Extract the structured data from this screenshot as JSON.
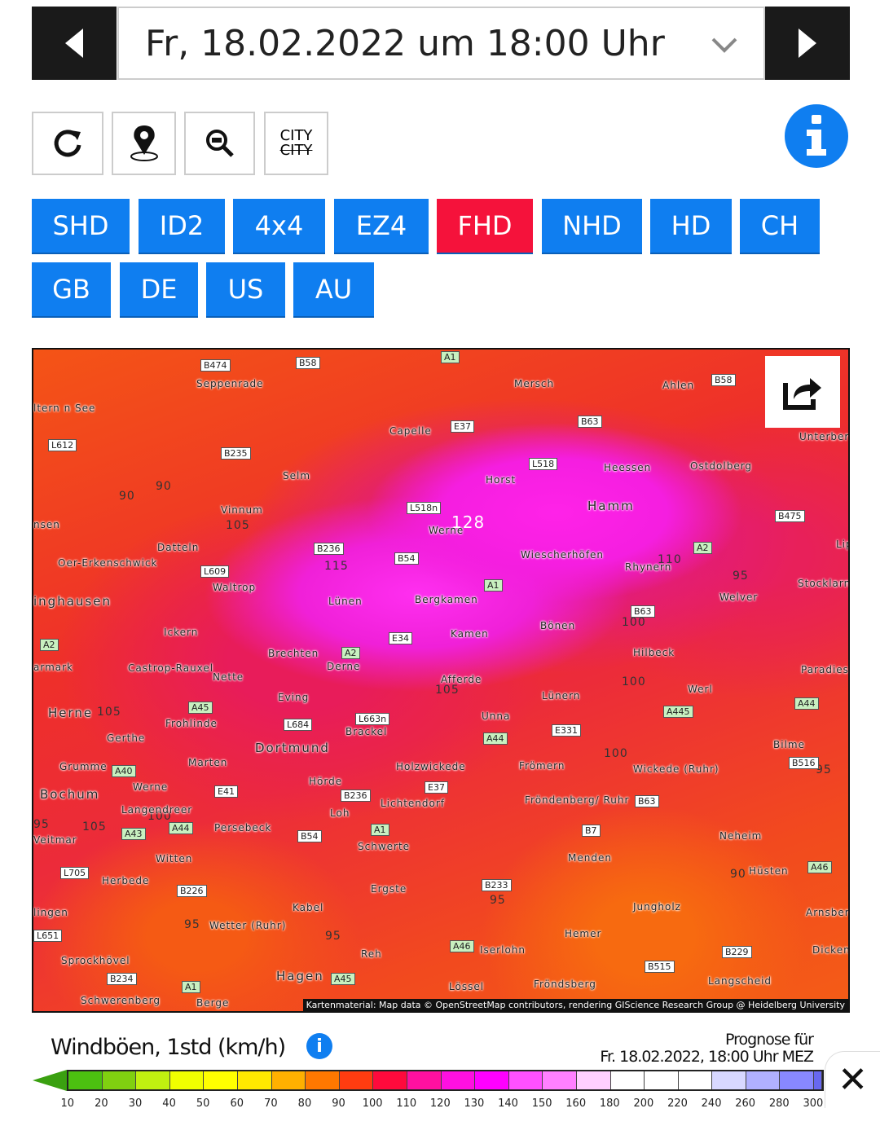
{
  "header": {
    "date_label": "Fr, 18.02.2022 um 18:00 Uhr",
    "prev_icon": "triangle-left",
    "next_icon": "triangle-right",
    "dropdown_icon": "chevron-down"
  },
  "toolbar": {
    "refresh_icon": "refresh",
    "location_icon": "map-pin",
    "zoom_out_icon": "zoom-out",
    "city_top": "CITY",
    "city_bottom": "CITY",
    "info_icon": "info"
  },
  "models": [
    {
      "label": "SHD"
    },
    {
      "label": "ID2"
    },
    {
      "label": "4x4"
    },
    {
      "label": "EZ4"
    },
    {
      "label": "FHD",
      "active": true
    },
    {
      "label": "NHD"
    },
    {
      "label": "HD"
    },
    {
      "label": "CH"
    },
    {
      "label": "GB"
    },
    {
      "label": "DE"
    },
    {
      "label": "US"
    },
    {
      "label": "AU"
    }
  ],
  "colors": {
    "accent": "#0f7ef0",
    "active": "#f5123b",
    "dark": "#1a1a1a"
  },
  "map": {
    "places": [
      "Seppenrade",
      "Mersch",
      "Ahlen",
      "Capelle",
      "Selm",
      "Horst",
      "Heessen",
      "Ostdolberg",
      "Hamm",
      "Werne",
      "Vinnum",
      "Datteln",
      "Oer-Erkenschwick",
      "Waltrop",
      "Lünen",
      "Bergkamen",
      "Wiescherhöfen",
      "Rhynern",
      "Welver",
      "Stocklarn",
      "Ickern",
      "Bönen",
      "Brechten",
      "Derne",
      "Kamen",
      "Hilbeck",
      "Castrop-Rauxel",
      "Nette",
      "Afferde",
      "Werl",
      "Eving",
      "Herne",
      "Lünern",
      "Unna",
      "Frohlinde",
      "Brackel",
      "Gerthe",
      "Dortmund",
      "Bilme",
      "Grumme",
      "Marten",
      "Holzwickede",
      "Frömern",
      "Wickede (Ruhr)",
      "Bochum",
      "Werne",
      "Hörde",
      "Langendreer",
      "Lichtendorf",
      "Fröndenberg/ Ruhr",
      "Loh",
      "Persebeck",
      "Schwerte",
      "Neheim",
      "Witten",
      "Menden",
      "Herbede",
      "Hüsten",
      "Ergste",
      "Kabel",
      "Jungholz",
      "Wetter (Ruhr)",
      "Hemer",
      "Reh",
      "Iserlohn",
      "Sprockhövel",
      "Hagen",
      "Lössel",
      "Fröndsberg",
      "Langscheid",
      "Schwerenberg",
      "Berge",
      "Unterber",
      "Lipp",
      "Paradies",
      "Arnsber",
      "Dicken",
      "lingen",
      "Veitmar",
      "armark",
      "inghausen",
      "nsen",
      "ltern n See"
    ],
    "roads": [
      "B474",
      "B58",
      "A1",
      "E37",
      "B63",
      "B58",
      "B235",
      "L612",
      "L518",
      "B475",
      "L518n",
      "B236",
      "B54",
      "A2",
      "L609",
      "A1",
      "B63",
      "E34",
      "A2",
      "A45",
      "L684",
      "L663n",
      "A445",
      "A44",
      "E331",
      "A44",
      "A40",
      "E41",
      "B236",
      "E37",
      "B516",
      "A43",
      "A44",
      "B54",
      "A1",
      "B63",
      "B7",
      "L705",
      "B226",
      "B233",
      "A46",
      "A46",
      "B229",
      "B515",
      "A45",
      "B234",
      "A1",
      "L651",
      "A2"
    ],
    "isolines": [
      "90",
      "90",
      "105",
      "115",
      "128",
      "110",
      "95",
      "100",
      "105",
      "100",
      "105",
      "100",
      "95",
      "105",
      "90",
      "95",
      "95",
      "95",
      "95",
      "100"
    ],
    "share_icon": "share",
    "attribution": "Kartenmaterial: Map data © OpenStreetMap contributors, rendering GIScience Research Group @ Heidelberg University"
  },
  "legend": {
    "title": "Windböen, 1std (km/h)",
    "info_icon": "info",
    "forecast_label": "Prognose für",
    "forecast_time": "Fr. 18.02.2022, 18:00 Uhr MEZ",
    "ticks": [
      "10",
      "20",
      "30",
      "40",
      "50",
      "60",
      "70",
      "80",
      "90",
      "100",
      "110",
      "120",
      "130",
      "140",
      "150",
      "160",
      "180",
      "200",
      "220",
      "240",
      "260",
      "280",
      "300"
    ],
    "colors": [
      "#4cc010",
      "#80d010",
      "#c0f010",
      "#f0ff00",
      "#ffff00",
      "#ffe800",
      "#ffb000",
      "#ff7800",
      "#ff3c10",
      "#ff0a3c",
      "#ff10a0",
      "#ff10e0",
      "#ff00ff",
      "#ff50ff",
      "#ff80ff",
      "#ffd0ff",
      "#ffffff",
      "#ffffff",
      "#ffffff",
      "#d8d8ff",
      "#b0b0ff",
      "#8888ff"
    ],
    "close_icon": "close"
  }
}
